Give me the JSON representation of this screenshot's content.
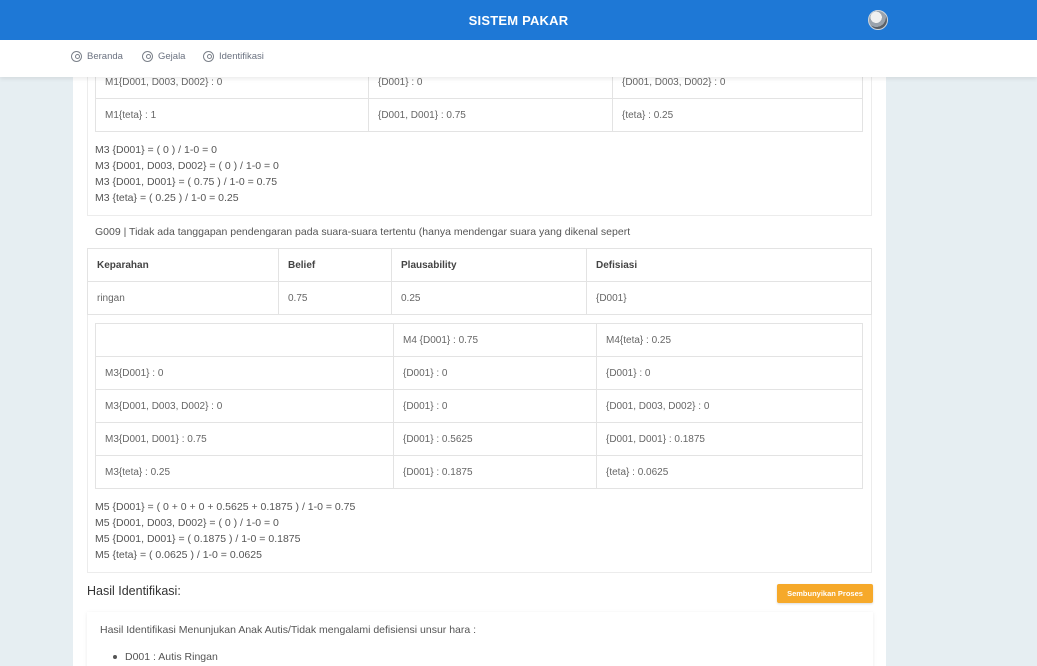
{
  "app": {
    "title": "SISTEM PAKAR"
  },
  "nav": [
    {
      "label": "Beranda"
    },
    {
      "label": "Gejala"
    },
    {
      "label": "Identifikasi"
    }
  ],
  "table_top": {
    "rows": [
      [
        "M1{D001, D003, D002} : 0",
        "{D001} : 0",
        "{D001, D003, D002} : 0"
      ],
      [
        "M1{teta} : 1",
        "{D001, D001} : 0.75",
        "{teta} : 0.25"
      ]
    ]
  },
  "calc_m3": [
    "M3 {D001} = ( 0 ) / 1-0 = 0",
    "M3 {D001, D003, D002} = ( 0 ) / 1-0 = 0",
    "M3 {D001, D001} = ( 0.75 ) / 1-0 = 0.75",
    "M3 {teta} = ( 0.25 ) / 1-0 = 0.25"
  ],
  "symptom": {
    "text": "G009 | Tidak ada tanggapan pendengaran pada suara-suara tertentu (hanya mendengar suara yang dikenal sepert"
  },
  "severity_table": {
    "headers": [
      "Keparahan",
      "Belief",
      "Plausability",
      "Defisiasi"
    ],
    "row": [
      "ringan",
      "0.75",
      "0.25",
      "{D001}"
    ]
  },
  "table_m4": {
    "header": [
      "",
      "M4 {D001} : 0.75",
      "M4{teta} : 0.25"
    ],
    "rows": [
      [
        "M3{D001} : 0",
        "{D001} : 0",
        "{D001} : 0"
      ],
      [
        "M3{D001, D003, D002} : 0",
        "{D001} : 0",
        "{D001, D003, D002} : 0"
      ],
      [
        "M3{D001, D001} : 0.75",
        "{D001} : 0.5625",
        "{D001, D001} : 0.1875"
      ],
      [
        "M3{teta} : 0.25",
        "{D001} : 0.1875",
        "{teta} : 0.0625"
      ]
    ]
  },
  "calc_m5": [
    "M5 {D001} = ( 0 + 0 + 0 + 0.5625 + 0.1875 ) / 1-0 = 0.75",
    "M5 {D001, D003, D002} = ( 0 ) / 1-0 = 0",
    "M5 {D001, D001} = ( 0.1875 ) / 1-0 = 0.1875",
    "M5 {teta} = ( 0.0625 ) / 1-0 = 0.0625"
  ],
  "result": {
    "heading": "Hasil Identifikasi:",
    "hide_button": "Sembunyikan Proses",
    "summary": "Hasil Identifikasi Menunjukan Anak Autis/Tidak mengalami defisiensi unsur hara :",
    "items": [
      "D001 : Autis Ringan"
    ]
  },
  "colors": {
    "primary": "#1e78d6",
    "accent": "#f6a92a"
  }
}
